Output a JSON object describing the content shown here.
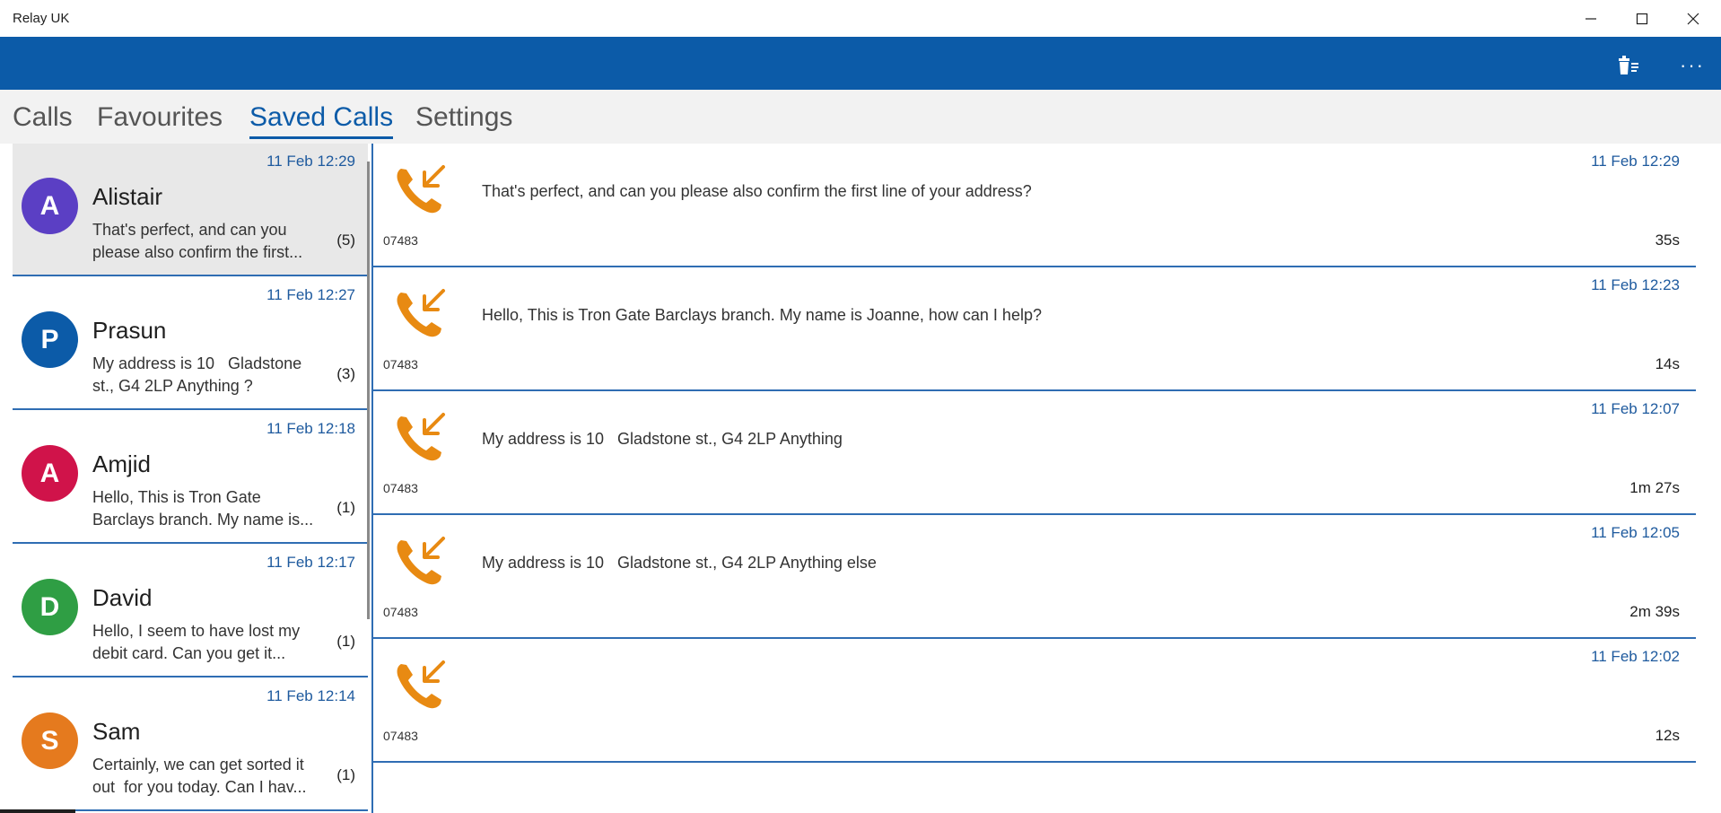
{
  "window": {
    "title": "Relay UK"
  },
  "colors": {
    "appbar": "#0c5ba8",
    "accent": "#1e5a9e",
    "phone_icon": "#e88a12"
  },
  "appbar": {
    "delete_icon": "delete-list-icon",
    "more_label": "···"
  },
  "tabs": [
    {
      "label": "Calls",
      "active": false
    },
    {
      "label": "Favourites",
      "active": false
    },
    {
      "label": "Saved Calls",
      "active": true
    },
    {
      "label": "Settings",
      "active": false
    }
  ],
  "contacts": [
    {
      "initial": "A",
      "name": "Alistair",
      "time": "11 Feb 12:29",
      "preview": "That's perfect, and can you please also confirm the first...",
      "count": "(5)",
      "color": "#5b3fc4",
      "selected": true
    },
    {
      "initial": "P",
      "name": "Prasun",
      "time": "11 Feb 12:27",
      "preview": "My address is 10   Gladstone st., G4 2LP Anything ?",
      "count": "(3)",
      "color": "#0c5ba8",
      "selected": false
    },
    {
      "initial": "A",
      "name": "Amjid",
      "time": "11 Feb 12:18",
      "preview": "Hello, This is Tron Gate Barclays branch. My name is...",
      "count": "(1)",
      "color": "#d0134a",
      "selected": false
    },
    {
      "initial": "D",
      "name": "David",
      "time": "11 Feb 12:17",
      "preview": "Hello, I seem to have lost my debit card. Can you get it...",
      "count": "(1)",
      "color": "#2f9e44",
      "selected": false
    },
    {
      "initial": "S",
      "name": "Sam",
      "time": "11 Feb 12:14",
      "preview": "Certainly, we can get sorted it out  for you today. Can I hav...",
      "count": "(1)",
      "color": "#e57a1e",
      "selected": false
    }
  ],
  "calls": [
    {
      "text": "That's perfect, and can you please also confirm the first line of your address?",
      "time": "11 Feb 12:29",
      "number": "07483",
      "duration": "35s"
    },
    {
      "text": "Hello, This is Tron Gate Barclays branch. My name is Joanne, how can I help?",
      "time": "11 Feb 12:23",
      "number": "07483",
      "duration": "14s"
    },
    {
      "text": "My address is 10   Gladstone st., G4 2LP Anything",
      "time": "11 Feb 12:07",
      "number": "07483",
      "duration": "1m 27s"
    },
    {
      "text": "My address is 10   Gladstone st., G4 2LP Anything else",
      "time": "11 Feb 12:05",
      "number": "07483",
      "duration": "2m 39s"
    },
    {
      "text": "",
      "time": "11 Feb 12:02",
      "number": "07483",
      "duration": "12s"
    }
  ]
}
